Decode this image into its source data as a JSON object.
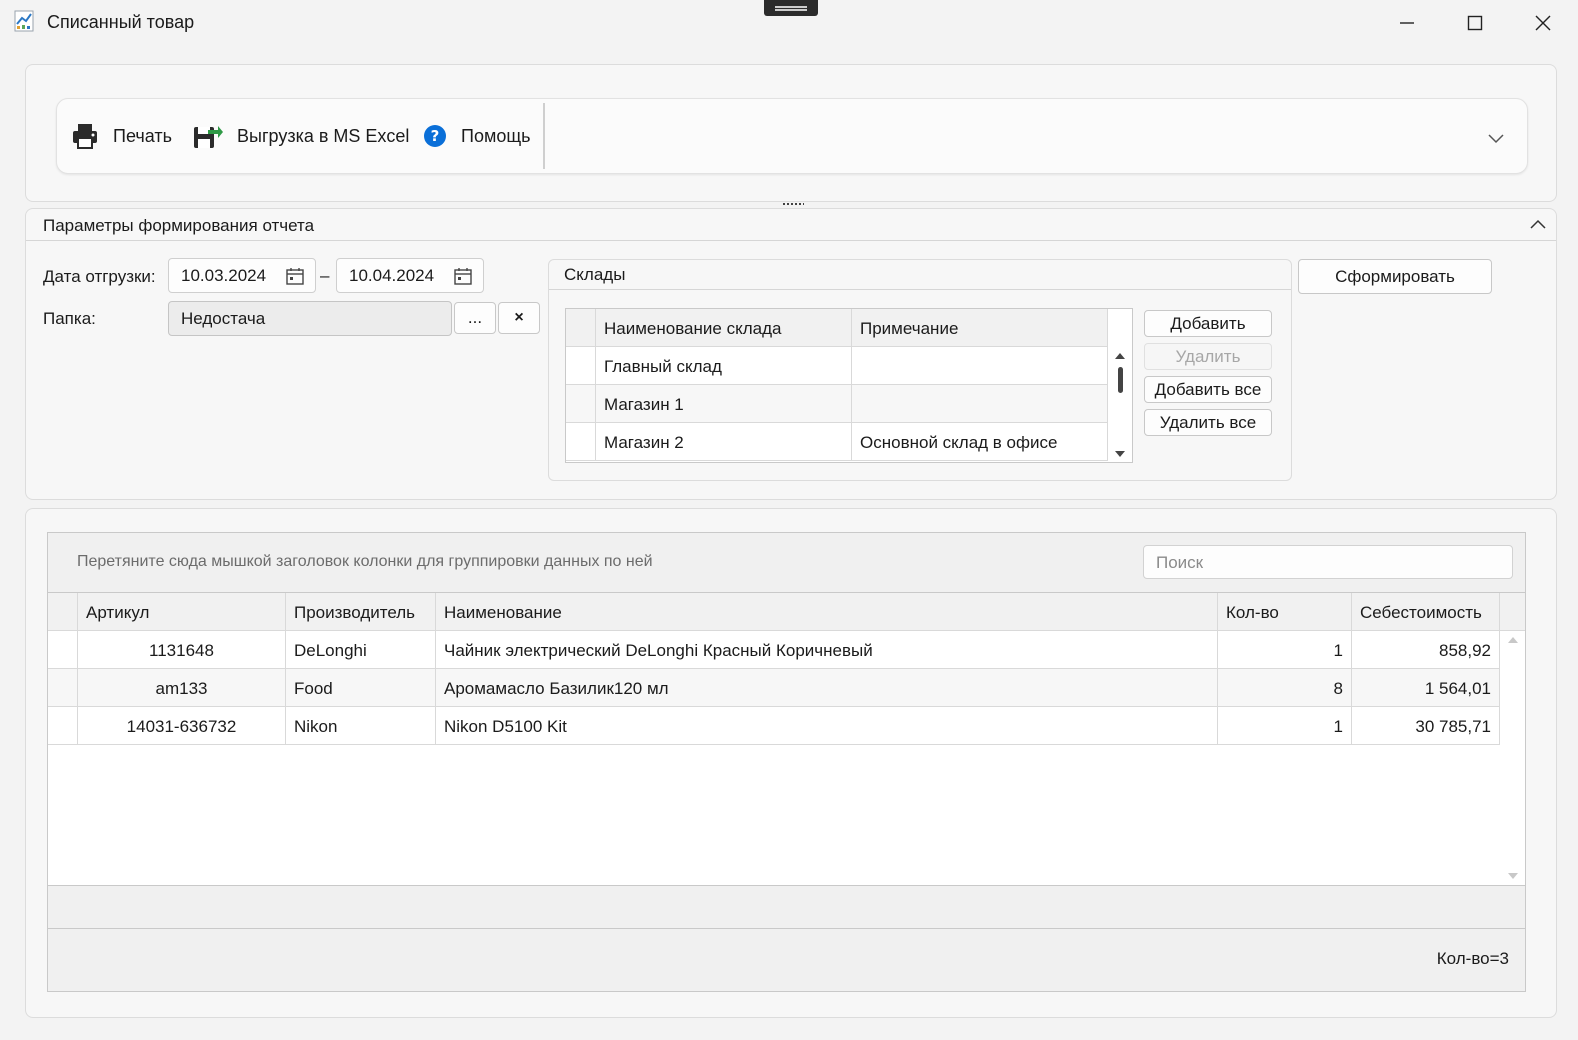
{
  "window": {
    "title": "Списанный товар"
  },
  "toolbar": {
    "print_label": "Печать",
    "excel_label": "Выгрузка в MS Excel",
    "help_label": "Помощь"
  },
  "params": {
    "header": "Параметры формирования отчета",
    "ship_date_label": "Дата отгрузки:",
    "date_from": "10.03.2024",
    "date_separator": "–",
    "date_to": "10.04.2024",
    "folder_label": "Папка:",
    "folder_value": "Недостача",
    "browse_label": "...",
    "clear_label": "×",
    "generate_label": "Сформировать"
  },
  "warehouses": {
    "caption": "Склады",
    "columns": [
      "Наименование склада",
      "Примечание"
    ],
    "rows": [
      {
        "name": "Главный склад",
        "note": ""
      },
      {
        "name": "Магазин 1",
        "note": ""
      },
      {
        "name": "Магазин 2",
        "note": "Основной склад в офисе"
      }
    ],
    "add_label": "Добавить",
    "delete_label": "Удалить",
    "add_all_label": "Добавить все",
    "delete_all_label": "Удалить все"
  },
  "grid": {
    "group_hint": "Перетяните сюда мышкой заголовок колонки для группировки данных по ней",
    "search_placeholder": "Поиск",
    "columns": [
      "Артикул",
      "Производитель",
      "Наименование",
      "Кол-во",
      "Себестоимость"
    ],
    "rows": [
      {
        "sku": "1131648",
        "maker": "DeLonghi",
        "name": "Чайник электрический DeLonghi Красный Коричневый",
        "qty": "1",
        "cost": "858,92"
      },
      {
        "sku": "am133",
        "maker": "Food",
        "name": "Аромамасло Базилик120 мл",
        "qty": "8",
        "cost": "1 564,01"
      },
      {
        "sku": "14031-636732",
        "maker": "Nikon",
        "name": "Nikon D5100 Kit",
        "qty": "1",
        "cost": "30 785,71"
      }
    ],
    "footer_count": "Кол-во=3"
  },
  "colors": {
    "accent_blue": "#0a6fd8",
    "excel_green": "#2f9a46"
  }
}
